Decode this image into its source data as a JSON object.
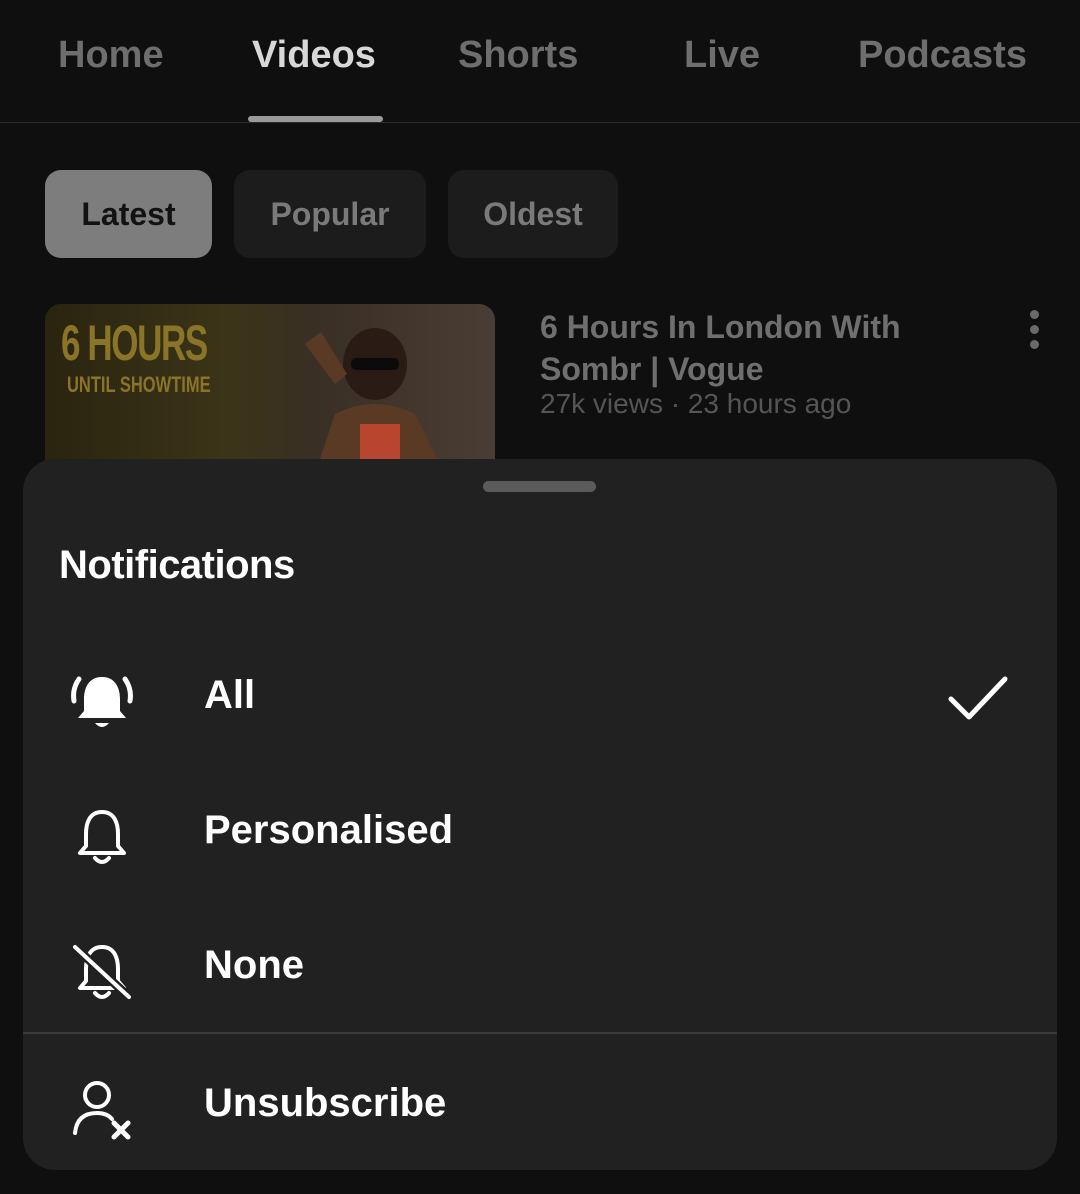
{
  "tabs": [
    {
      "label": "Home"
    },
    {
      "label": "Videos"
    },
    {
      "label": "Shorts"
    },
    {
      "label": "Live"
    },
    {
      "label": "Podcasts"
    }
  ],
  "filters": [
    {
      "label": "Latest"
    },
    {
      "label": "Popular"
    },
    {
      "label": "Oldest"
    }
  ],
  "video": {
    "thumb_title": "6 HOURS",
    "thumb_subtitle": "UNTIL SHOWTIME",
    "title": "6 Hours In London With Sombr | Vogue",
    "meta": "27k views · 23 hours ago"
  },
  "sheet": {
    "title": "Notifications",
    "options": [
      {
        "label": "All",
        "icon": "bell-ringing-icon",
        "selected": true
      },
      {
        "label": "Personalised",
        "icon": "bell-icon",
        "selected": false
      },
      {
        "label": "None",
        "icon": "bell-off-icon",
        "selected": false
      }
    ],
    "unsubscribe_label": "Unsubscribe"
  }
}
